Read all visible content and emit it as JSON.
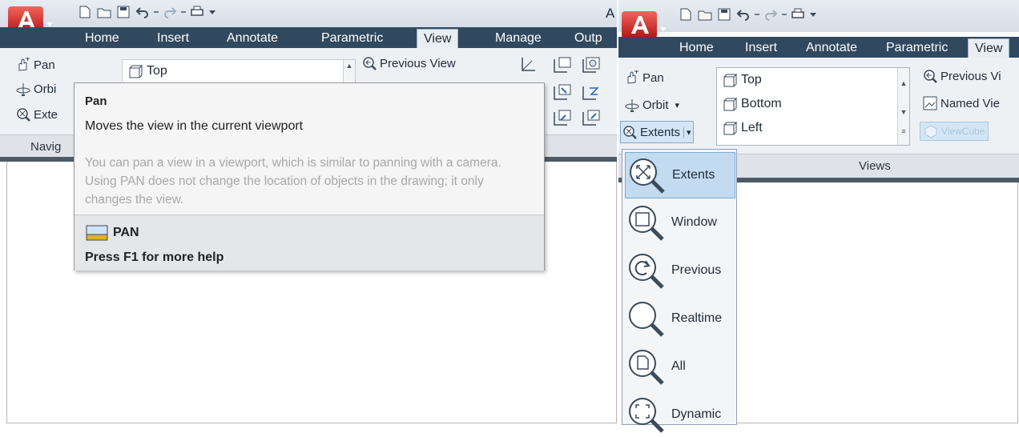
{
  "left": {
    "app_title_initial": "A",
    "tabs": [
      "Home",
      "Insert",
      "Annotate",
      "Parametric",
      "View",
      "Manage",
      "Outp"
    ],
    "active_tab": "View",
    "navigate_buttons": [
      "Pan",
      "Orbi",
      "Exte"
    ],
    "navigate_panel_label": "Navig",
    "views_first_item": "Top",
    "previous_view_label": "Previous View",
    "tooltip": {
      "title": "Pan",
      "subtitle": "Moves the view in the current viewport",
      "description": "You can pan a view in a viewport, which is similar to panning with a camera. Using PAN does not change the location of objects in the drawing; it only changes the view.",
      "command": "PAN",
      "help": "Press F1 for more help"
    }
  },
  "right": {
    "tabs": [
      "Home",
      "Insert",
      "Annotate",
      "Parametric",
      "View"
    ],
    "active_tab": "View",
    "navigate_buttons": {
      "pan": "Pan",
      "orbit": "Orbit",
      "orbit_arrow": "▾",
      "extents": "Extents",
      "extents_arrow": "▾"
    },
    "views_list": [
      "Top",
      "Bottom",
      "Left"
    ],
    "previous_view_label": "Previous Vi",
    "named_view_label": "Named Vie",
    "viewcube_label": "ViewCube",
    "views_panel_label": "Views",
    "zoom_menu": [
      "Extents",
      "Window",
      "Previous",
      "Realtime",
      "All",
      "Dynamic"
    ],
    "zoom_selected": "Extents"
  },
  "colors": {
    "tab_bar": "#31495f",
    "ribbon": "#eef1f4",
    "selection": "#c2dbf0",
    "tooltip_body_text": "#a8a8a8"
  }
}
